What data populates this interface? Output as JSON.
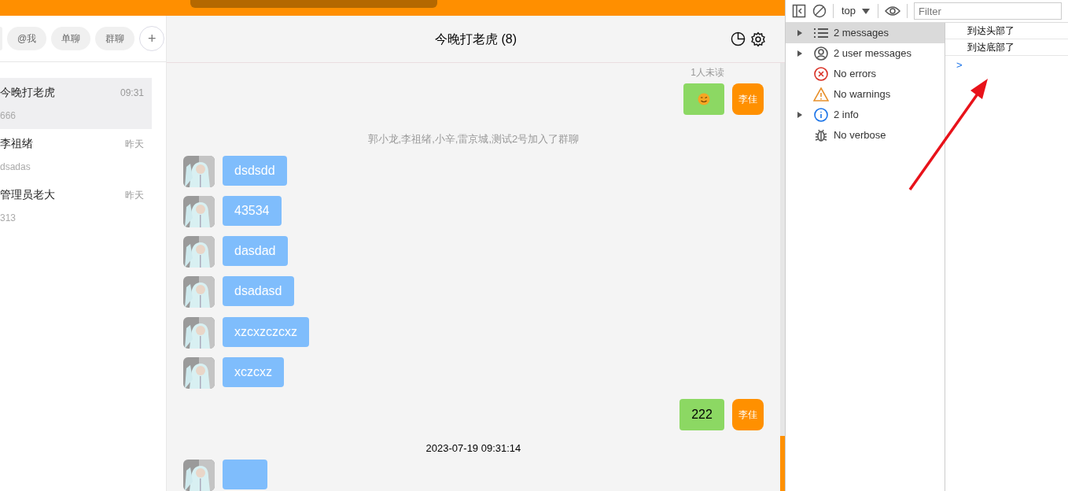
{
  "filter_tabs": [
    {
      "label": "@我",
      "selected": false
    },
    {
      "label": "单聊",
      "selected": false
    },
    {
      "label": "群聊",
      "selected": false
    }
  ],
  "add_button": "+",
  "conversations": [
    {
      "name": "今晚打老虎",
      "time": "09:31",
      "preview": "666",
      "selected": true
    },
    {
      "name": "李祖绪",
      "time": "昨天",
      "preview": "dsadas",
      "selected": false
    },
    {
      "name": "管理员老大",
      "time": "昨天",
      "preview": "313",
      "selected": false
    }
  ],
  "chat": {
    "title": "今晚打老虎 (8)",
    "messages": [
      {
        "kind": "receipt",
        "text": "1人未读"
      },
      {
        "kind": "mine_emoji",
        "avatar": "李佳"
      },
      {
        "kind": "system",
        "text": "郭小龙,李祖绪,小辛,雷京城,测试2号加入了群聊"
      },
      {
        "kind": "theirs",
        "text": "dsdsdd"
      },
      {
        "kind": "theirs",
        "text": "43534"
      },
      {
        "kind": "theirs",
        "text": "dasdad"
      },
      {
        "kind": "theirs",
        "text": "dsadasd"
      },
      {
        "kind": "theirs",
        "text": "xzcxzczcxz"
      },
      {
        "kind": "theirs",
        "text": "xczcxz"
      },
      {
        "kind": "mine",
        "text": "222",
        "avatar": "李佳"
      },
      {
        "kind": "time",
        "text": "2023-07-19 09:31:14"
      }
    ]
  },
  "devtools": {
    "context": "top",
    "filter_placeholder": "Filter",
    "sidebar": [
      {
        "label": "2 messages",
        "kind": "list",
        "expandable": true,
        "selected": true
      },
      {
        "label": "2 user messages",
        "kind": "user",
        "expandable": true,
        "selected": false
      },
      {
        "label": "No errors",
        "kind": "error",
        "expandable": false,
        "selected": false
      },
      {
        "label": "No warnings",
        "kind": "warning",
        "expandable": false,
        "selected": false
      },
      {
        "label": "2 info",
        "kind": "info",
        "expandable": true,
        "selected": false
      },
      {
        "label": "No verbose",
        "kind": "verbose",
        "expandable": false,
        "selected": false
      }
    ],
    "console": [
      "到达头部了",
      "到达底部了"
    ],
    "prompt": ">"
  }
}
